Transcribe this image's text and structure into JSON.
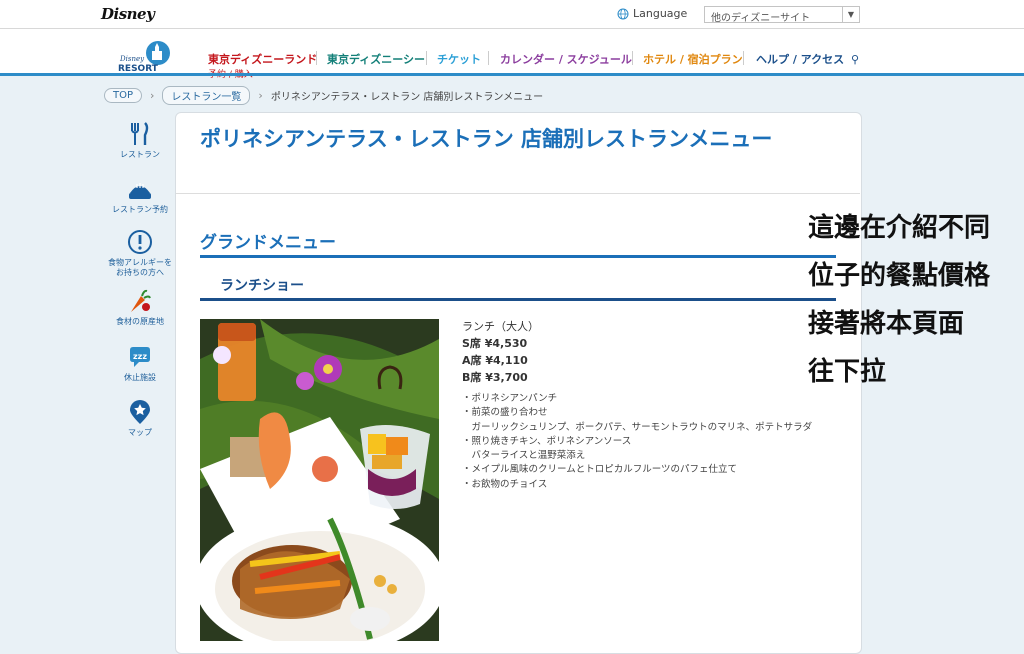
{
  "header": {
    "brand": "Disney",
    "language_label": "Language",
    "site_select_value": "他のディズニーサイト"
  },
  "logo": {
    "line1": "Disney",
    "line2": "RESORT"
  },
  "nav": {
    "items": [
      {
        "label": "東京ディズニーランド",
        "color": "#c4161c"
      },
      {
        "label": "東京ディズニーシー",
        "color": "#127f78"
      },
      {
        "label": "チケット",
        "color": "#2a9fd6"
      },
      {
        "label": "カレンダー / スケジュール",
        "color": "#8b3d9e"
      },
      {
        "label": "ホテル / 宿泊プラン",
        "color": "#e0870e"
      },
      {
        "label": "ヘルプ / アクセス",
        "color": "#1b4f8a"
      }
    ],
    "extra_label": "予約 / 購入"
  },
  "breadcrumb": {
    "top": "TOP",
    "list": "レストラン一覧",
    "current": "ポリネシアンテラス・レストラン 店舗別レストランメニュー"
  },
  "sidebar": {
    "items": [
      {
        "label": "レストラン",
        "icon": "fork-knife-icon"
      },
      {
        "label": "レストラン予約",
        "icon": "reserve-icon"
      },
      {
        "label": "食物アレルギーを\nお持ちの方へ",
        "icon": "exclamation-icon"
      },
      {
        "label": "食材の原産地",
        "icon": "carrot-icon"
      },
      {
        "label": "休止施設",
        "icon": "sleep-icon"
      },
      {
        "label": "マップ",
        "icon": "map-pin-icon"
      }
    ]
  },
  "page": {
    "title": "ポリネシアンテラス・レストラン 店舗別レストランメニュー",
    "section_title": "グランドメニュー",
    "subsection_title": "ランチショー"
  },
  "menu": {
    "name": "ランチ（大人）",
    "prices": [
      "S席 ¥4,530",
      "A席 ¥4,110",
      "B席 ¥3,700"
    ],
    "items": [
      "・ポリネシアンパンチ",
      "・前菜の盛り合わせ",
      "　ガーリックシュリンプ、ポークパテ、サーモントラウトのマリネ、ポテトサラダ",
      "・照り焼きチキン、ポリネシアンソース",
      "　バターライスと温野菜添え",
      "・メイプル風味のクリームとトロピカルフルーツのパフェ仕立て",
      "・お飲物のチョイス"
    ]
  },
  "annotation": {
    "lines": [
      "這邊在介紹不同",
      "位子的餐點價格",
      "接著將本頁面",
      "往下拉"
    ]
  }
}
